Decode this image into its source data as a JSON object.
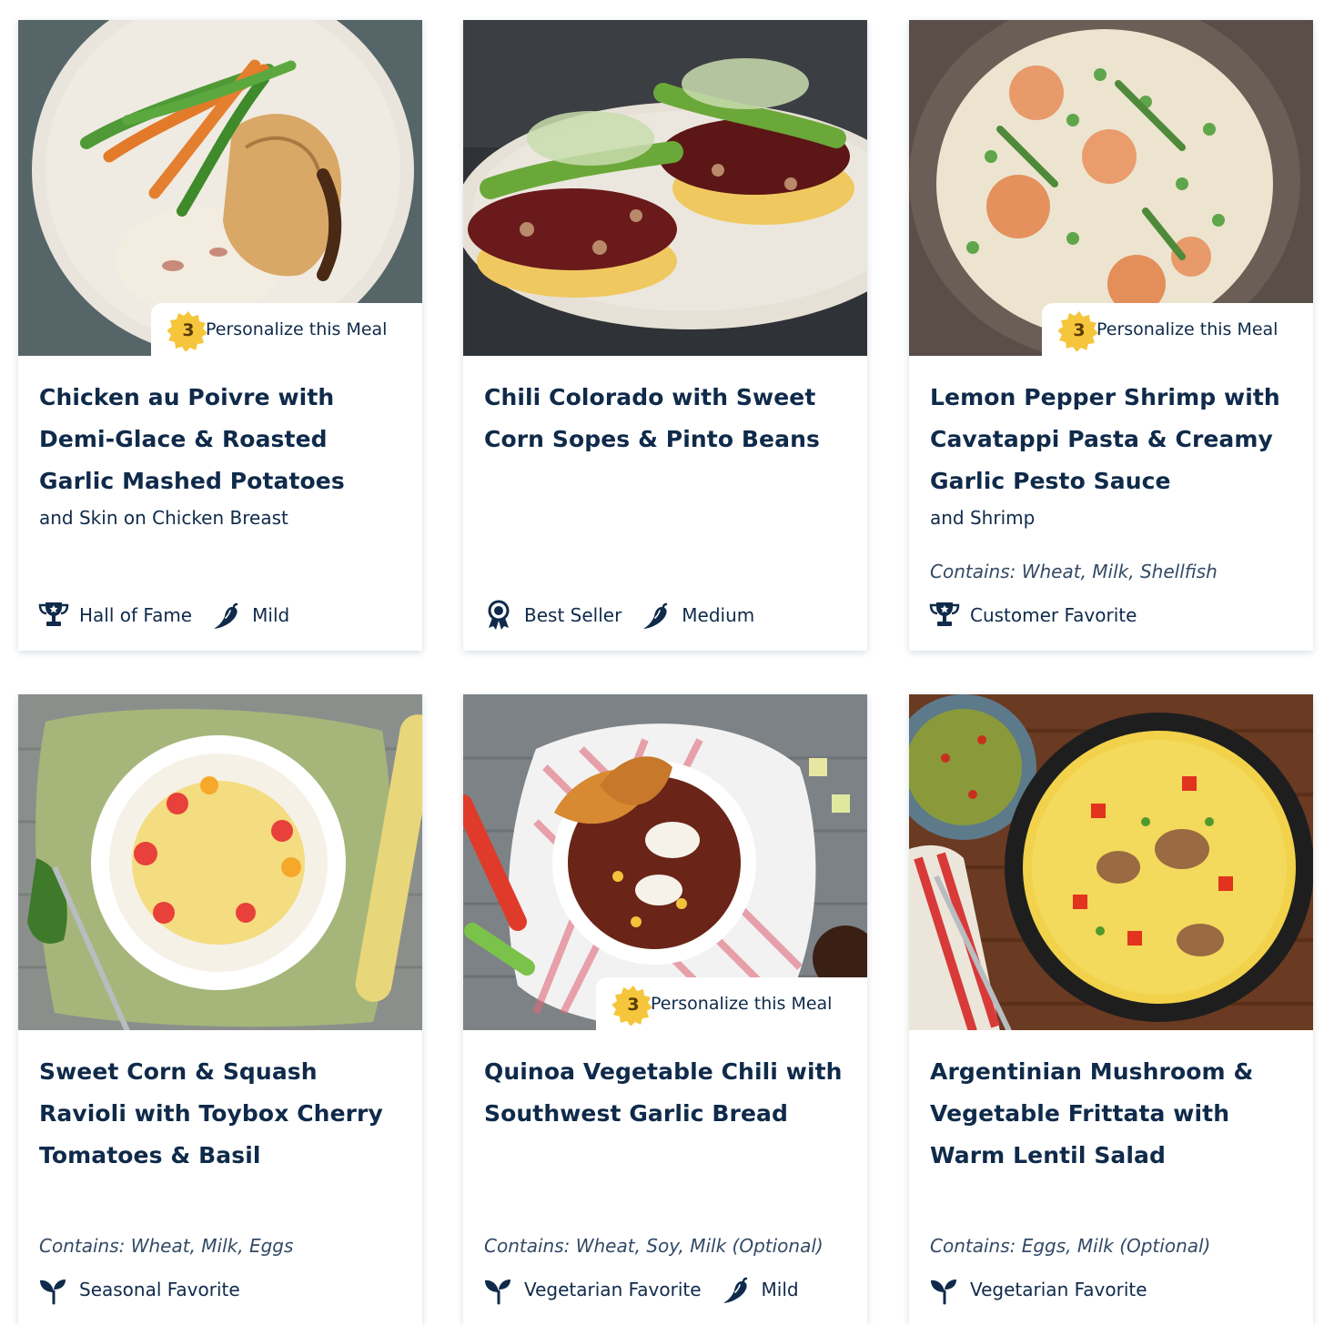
{
  "personalize_label": "Personalize this Meal",
  "personalize_count": "3",
  "colors": {
    "text": "#0f2a4a",
    "badge_star": "#f5c53c",
    "card_shadow": "#cfd6df"
  },
  "meals": [
    {
      "title": "Chicken au Poivre with Demi-Glace & Roasted Garlic Mashed Potatoes",
      "subtitle": "and Skin on Chicken Breast",
      "contains": "",
      "personalize": true,
      "tags": [
        {
          "icon": "trophy-icon",
          "label": "Hall of Fame"
        },
        {
          "icon": "chili-pepper-icon",
          "label": "Mild"
        }
      ]
    },
    {
      "title": "Chili Colorado with Sweet Corn Sopes & Pinto Beans",
      "subtitle": "",
      "contains": "",
      "personalize": false,
      "tags": [
        {
          "icon": "award-ribbon-icon",
          "label": "Best Seller"
        },
        {
          "icon": "chili-pepper-icon",
          "label": "Medium"
        }
      ]
    },
    {
      "title": "Lemon Pepper Shrimp with Cavatappi Pasta & Creamy Garlic Pesto Sauce",
      "subtitle": "and Shrimp",
      "contains": "Contains: Wheat, Milk, Shellfish",
      "personalize": true,
      "tags": [
        {
          "icon": "trophy-icon",
          "label": "Customer Favorite"
        }
      ]
    },
    {
      "title": "Sweet Corn & Squash Ravioli with Toybox Cherry Tomatoes & Basil",
      "subtitle": "",
      "contains": "Contains: Wheat, Milk, Eggs",
      "personalize": false,
      "tags": [
        {
          "icon": "sprout-icon",
          "label": "Seasonal Favorite"
        }
      ]
    },
    {
      "title": "Quinoa Vegetable Chili with Southwest Garlic Bread",
      "subtitle": "",
      "contains": "Contains: Wheat, Soy, Milk (Optional)",
      "personalize": true,
      "tags": [
        {
          "icon": "sprout-icon",
          "label": "Vegetarian Favorite"
        },
        {
          "icon": "chili-pepper-icon",
          "label": "Mild"
        }
      ]
    },
    {
      "title": "Argentinian Mushroom & Vegetable Frittata with Warm Lentil Salad",
      "subtitle": "",
      "contains": "Contains: Eggs, Milk (Optional)",
      "personalize": false,
      "tags": [
        {
          "icon": "sprout-icon",
          "label": "Vegetarian Favorite"
        }
      ]
    }
  ]
}
